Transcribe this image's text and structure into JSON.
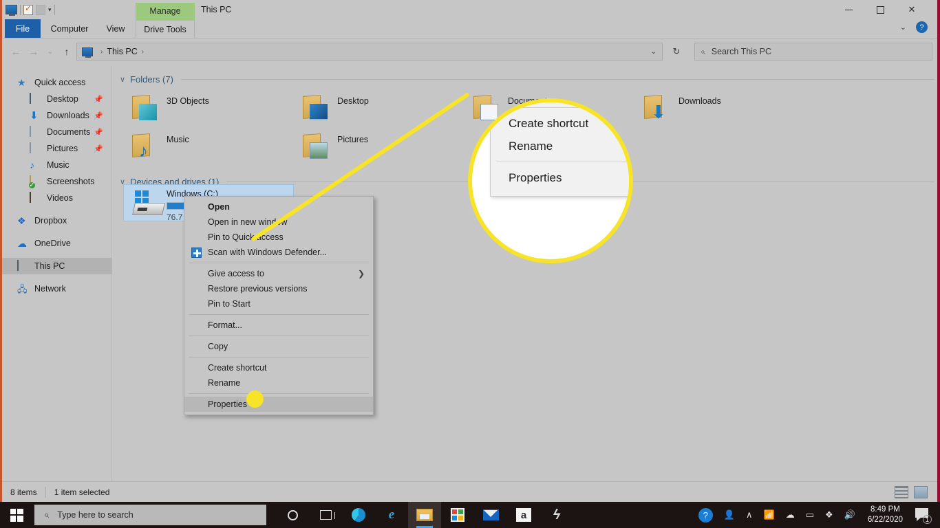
{
  "window": {
    "title": "This PC",
    "ribbon_context_tab": "Manage",
    "quick_access_icons": [
      "this-pc-icon",
      "properties-icon",
      "new-folder-icon",
      "customize-caret-icon"
    ],
    "controls": {
      "minimize": "minimize-button",
      "maximize": "maximize-button",
      "close": "close-button"
    }
  },
  "ribbon": {
    "tabs": [
      {
        "label": "File",
        "active": true
      },
      {
        "label": "Computer",
        "active": false
      },
      {
        "label": "View",
        "active": false
      },
      {
        "label": "Drive Tools",
        "active": false,
        "contextual": true
      }
    ],
    "collapse_label": "⌄",
    "help_label": "?"
  },
  "addressbar": {
    "back": "←",
    "forward": "→",
    "recent": "⌄",
    "up": "↑",
    "breadcrumb": [
      "This PC"
    ],
    "separator": "›",
    "dropdown_caret": "⌄",
    "refresh": "↻"
  },
  "search": {
    "placeholder": "Search This PC",
    "icon": "search-icon"
  },
  "sidebar": {
    "items": [
      {
        "label": "Quick access",
        "icon": "star-icon",
        "level": 0,
        "pinned": false,
        "selected": false
      },
      {
        "label": "Desktop",
        "icon": "desktop-icon",
        "level": 1,
        "pinned": true,
        "selected": false
      },
      {
        "label": "Downloads",
        "icon": "downloads-icon",
        "level": 1,
        "pinned": true,
        "selected": false
      },
      {
        "label": "Documents",
        "icon": "documents-icon",
        "level": 1,
        "pinned": true,
        "selected": false
      },
      {
        "label": "Pictures",
        "icon": "pictures-icon",
        "level": 1,
        "pinned": true,
        "selected": false
      },
      {
        "label": "Music",
        "icon": "music-icon",
        "level": 1,
        "pinned": false,
        "selected": false
      },
      {
        "label": "Screenshots",
        "icon": "screenshots-folder-icon",
        "level": 1,
        "pinned": false,
        "selected": false
      },
      {
        "label": "Videos",
        "icon": "videos-icon",
        "level": 1,
        "pinned": false,
        "selected": false
      },
      {
        "label": "Dropbox",
        "icon": "dropbox-icon",
        "level": 0,
        "pinned": false,
        "selected": false
      },
      {
        "label": "OneDrive",
        "icon": "onedrive-icon",
        "level": 0,
        "pinned": false,
        "selected": false
      },
      {
        "label": "This PC",
        "icon": "this-pc-icon",
        "level": 0,
        "pinned": false,
        "selected": true
      },
      {
        "label": "Network",
        "icon": "network-icon",
        "level": 0,
        "pinned": false,
        "selected": false
      }
    ],
    "pin_glyph": "📌"
  },
  "content": {
    "groups": [
      {
        "title": "Folders (7)",
        "chevron": "∨"
      },
      {
        "title": "Devices and drives (1)",
        "chevron": "∨"
      }
    ],
    "folders": [
      {
        "label": "3D Objects",
        "icon": "3d-objects-folder-icon"
      },
      {
        "label": "Desktop",
        "icon": "desktop-folder-icon"
      },
      {
        "label": "Documents",
        "icon": "documents-folder-icon"
      },
      {
        "label": "Downloads",
        "icon": "downloads-folder-icon"
      },
      {
        "label": "Music",
        "icon": "music-folder-icon"
      },
      {
        "label": "Pictures",
        "icon": "pictures-folder-icon"
      }
    ],
    "drive": {
      "name": "Windows (C:)",
      "free_text": "76.7 G",
      "fill_percent": 58,
      "icon": "windows-drive-icon",
      "selected": true
    }
  },
  "context_menu": {
    "items": [
      {
        "label": "Open",
        "bold": true,
        "accel": "O",
        "separator_after": false
      },
      {
        "label": "Open in new window",
        "bold": false,
        "accel": "e",
        "separator_after": false
      },
      {
        "label": "Pin to Quick access",
        "bold": false,
        "accel": "P",
        "separator_after": false
      },
      {
        "label": "Scan with Windows Defender...",
        "bold": false,
        "icon": "windows-defender-icon",
        "separator_after": true
      },
      {
        "label": "Give access to",
        "bold": false,
        "accel": "G",
        "submenu": true,
        "separator_after": false
      },
      {
        "label": "Restore previous versions",
        "bold": false,
        "accel": "v",
        "separator_after": false
      },
      {
        "label": "Pin to Start",
        "bold": false,
        "accel": "P",
        "separator_after": true
      },
      {
        "label": "Format...",
        "bold": false,
        "accel": "a",
        "separator_after": true
      },
      {
        "label": "Copy",
        "bold": false,
        "accel": "C",
        "separator_after": true
      },
      {
        "label": "Create shortcut",
        "bold": false,
        "accel": "s",
        "separator_after": false
      },
      {
        "label": "Rename",
        "bold": false,
        "accel": "m",
        "separator_after": true
      },
      {
        "label": "Properties",
        "bold": false,
        "accel": "r",
        "highlighted": true,
        "separator_after": false
      }
    ]
  },
  "magnifier": {
    "items": [
      "Create shortcut",
      "Rename",
      "Properties"
    ],
    "highlight_color": "#f7e327",
    "callout_target": "Properties"
  },
  "statusbar": {
    "item_count": "8 items",
    "selection": "1 item selected",
    "view_buttons": [
      "details-view-icon",
      "large-icons-view-icon"
    ]
  },
  "taskbar": {
    "start_label": "start-button",
    "search_placeholder": "Type here to search",
    "search_icon": "search-icon",
    "apps": [
      {
        "name": "cortana-icon",
        "active": false
      },
      {
        "name": "task-view-icon",
        "active": false
      },
      {
        "name": "microsoft-edge-icon",
        "active": false
      },
      {
        "name": "internet-explorer-icon",
        "active": false
      },
      {
        "name": "file-explorer-icon",
        "active": true
      },
      {
        "name": "microsoft-store-icon",
        "active": false
      },
      {
        "name": "mail-icon",
        "active": false
      },
      {
        "name": "amazon-icon",
        "active": false
      },
      {
        "name": "skype-icon",
        "active": false
      }
    ],
    "tray": {
      "help_label": "?",
      "people_icon": "people-icon",
      "overflow_icon": "∧",
      "wifi_icon": "wifi-icon",
      "onedrive_icon": "onedrive-tray-icon",
      "battery_icon": "battery-icon",
      "dropbox_icon": "dropbox-tray-icon",
      "volume_icon": "volume-icon"
    },
    "clock": {
      "time": "8:49 PM",
      "date": "6/22/2020"
    },
    "notification_badge": "1"
  }
}
